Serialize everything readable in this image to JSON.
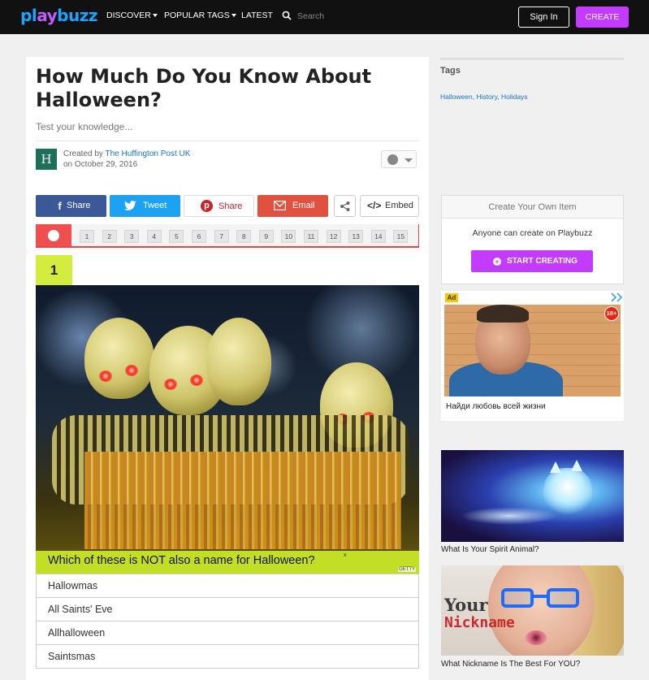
{
  "topbar": {
    "logo": "playbuzz",
    "nav": {
      "discover": "DISCOVER",
      "popular_tags": "POPULAR TAGS",
      "latest": "LATEST"
    },
    "search_placeholder": "Search",
    "signin": "Sign In",
    "create": "CREATE"
  },
  "article": {
    "title": "How Much Do You Know About Halloween?",
    "subtitle": "Test your knowledge...",
    "author_avatar_letter": "H",
    "created_by_label": "Created by",
    "author": "The Huffington Post UK",
    "date": "on October 29, 2016"
  },
  "share": {
    "facebook": "Share",
    "twitter": "Tweet",
    "pinterest": "Share",
    "email": "Email",
    "embed": "Embed"
  },
  "progress": {
    "steps": [
      "1",
      "2",
      "3",
      "4",
      "5",
      "6",
      "7",
      "8",
      "9",
      "10",
      "11",
      "12",
      "13",
      "14",
      "15"
    ]
  },
  "question": {
    "number": "1",
    "text": "Which of these is NOT also a name for Halloween?",
    "close": "x",
    "credit": "GETTY",
    "answers": [
      "Hallowmas",
      "All Saints' Eve",
      "Allhalloween",
      "Saintsmas"
    ]
  },
  "sidebar": {
    "tags_heading": "Tags",
    "tags": "Halloween, History, Holidays",
    "create_box": {
      "heading": "Create Your Own Item",
      "text": "Anyone can create on Playbuzz",
      "button": "START CREATING"
    },
    "ad": {
      "tag": "Ad",
      "age_badge": "18+",
      "caption": "Найди любовь всей жизни"
    },
    "cards": [
      {
        "caption": "What Is Your Spirit Animal?"
      },
      {
        "caption": "What Nickname Is The Best For YOU?",
        "overlay_line1": "Your",
        "overlay_line2": "Nickname"
      }
    ]
  },
  "colors": {
    "brand_blue": "#1aa3ff",
    "brand_purple": "#c33bff",
    "question_yellow": "#d4ec3d",
    "facebook": "#3b5998",
    "twitter": "#1da1f2",
    "email": "#e25140"
  }
}
